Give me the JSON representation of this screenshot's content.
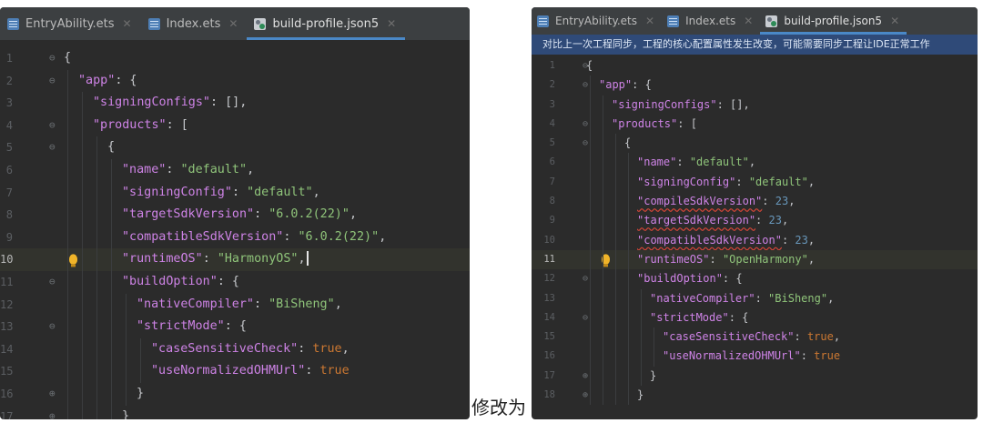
{
  "left": {
    "tabs": [
      {
        "label": "EntryAbility.ets",
        "icon": "ets-file-icon",
        "active": false
      },
      {
        "label": "Index.ets",
        "icon": "ets-file-icon",
        "active": false
      },
      {
        "label": "build-profile.json5",
        "icon": "json5-file-icon",
        "active": true
      }
    ],
    "lines": [
      {
        "num": "1",
        "fold": "⊖",
        "indent": 0,
        "tokens": [
          [
            "p",
            "{"
          ]
        ]
      },
      {
        "num": "2",
        "fold": "⊖",
        "indent": 1,
        "tokens": [
          [
            "k",
            "\"app\""
          ],
          [
            "p",
            ": {"
          ]
        ]
      },
      {
        "num": "3",
        "fold": "",
        "indent": 2,
        "tokens": [
          [
            "k",
            "\"signingConfigs\""
          ],
          [
            "p",
            ": [],"
          ]
        ]
      },
      {
        "num": "4",
        "fold": "⊖",
        "indent": 2,
        "tokens": [
          [
            "k",
            "\"products\""
          ],
          [
            "p",
            ": ["
          ]
        ]
      },
      {
        "num": "5",
        "fold": "⊖",
        "indent": 3,
        "tokens": [
          [
            "p",
            "{"
          ]
        ]
      },
      {
        "num": "6",
        "fold": "",
        "indent": 4,
        "tokens": [
          [
            "k",
            "\"name\""
          ],
          [
            "p",
            ": "
          ],
          [
            "s",
            "\"default\""
          ],
          [
            "p",
            ","
          ]
        ]
      },
      {
        "num": "7",
        "fold": "",
        "indent": 4,
        "tokens": [
          [
            "k",
            "\"signingConfig\""
          ],
          [
            "p",
            ": "
          ],
          [
            "s",
            "\"default\""
          ],
          [
            "p",
            ","
          ]
        ]
      },
      {
        "num": "8",
        "fold": "",
        "indent": 4,
        "tokens": [
          [
            "k",
            "\"targetSdkVersion\""
          ],
          [
            "p",
            ": "
          ],
          [
            "s",
            "\"6.0.2(22)\""
          ],
          [
            "p",
            ","
          ]
        ]
      },
      {
        "num": "9",
        "fold": "",
        "indent": 4,
        "tokens": [
          [
            "k",
            "\"compatibleSdkVersion\""
          ],
          [
            "p",
            ": "
          ],
          [
            "s",
            "\"6.0.2(22)\""
          ],
          [
            "p",
            ","
          ]
        ]
      },
      {
        "num": "10",
        "fold": "",
        "indent": 4,
        "current": true,
        "bulb": true,
        "caret": true,
        "tokens": [
          [
            "k",
            "\"runtimeOS\""
          ],
          [
            "p",
            ": "
          ],
          [
            "s",
            "\"HarmonyOS\""
          ],
          [
            "p",
            ","
          ]
        ]
      },
      {
        "num": "11",
        "fold": "⊖",
        "indent": 4,
        "tokens": [
          [
            "k",
            "\"buildOption\""
          ],
          [
            "p",
            ": {"
          ]
        ]
      },
      {
        "num": "12",
        "fold": "",
        "indent": 5,
        "tokens": [
          [
            "k",
            "\"nativeCompiler\""
          ],
          [
            "p",
            ": "
          ],
          [
            "s",
            "\"BiSheng\""
          ],
          [
            "p",
            ","
          ]
        ]
      },
      {
        "num": "13",
        "fold": "⊖",
        "indent": 5,
        "tokens": [
          [
            "k",
            "\"strictMode\""
          ],
          [
            "p",
            ": {"
          ]
        ]
      },
      {
        "num": "14",
        "fold": "",
        "indent": 6,
        "tokens": [
          [
            "k",
            "\"caseSensitiveCheck\""
          ],
          [
            "p",
            ": "
          ],
          [
            "b",
            "true"
          ],
          [
            "p",
            ","
          ]
        ]
      },
      {
        "num": "15",
        "fold": "",
        "indent": 6,
        "tokens": [
          [
            "k",
            "\"useNormalizedOHMUrl\""
          ],
          [
            "p",
            ": "
          ],
          [
            "b",
            "true"
          ]
        ]
      },
      {
        "num": "16",
        "fold": "⊕",
        "indent": 5,
        "tokens": [
          [
            "p",
            "}"
          ]
        ]
      },
      {
        "num": "17",
        "fold": "⊕",
        "indent": 4,
        "tokens": [
          [
            "p",
            "}"
          ]
        ]
      }
    ]
  },
  "between_label": "修改为",
  "right": {
    "tabs": [
      {
        "label": "EntryAbility.ets",
        "icon": "ets-file-icon",
        "active": false
      },
      {
        "label": "Index.ets",
        "icon": "ets-file-icon",
        "active": false
      },
      {
        "label": "build-profile.json5",
        "icon": "json5-file-icon",
        "active": true
      }
    ],
    "notice": "对比上一次工程同步，工程的核心配置属性发生改变，可能需要同步工程让IDE正常工作",
    "lines": [
      {
        "num": "1",
        "fold": "⊖",
        "indent": 0,
        "tokens": [
          [
            "p",
            "{"
          ]
        ]
      },
      {
        "num": "2",
        "fold": "⊖",
        "indent": 1,
        "tokens": [
          [
            "k",
            "\"app\""
          ],
          [
            "p",
            ": {"
          ]
        ]
      },
      {
        "num": "3",
        "fold": "",
        "indent": 2,
        "tokens": [
          [
            "k",
            "\"signingConfigs\""
          ],
          [
            "p",
            ": [],"
          ]
        ]
      },
      {
        "num": "4",
        "fold": "⊖",
        "indent": 2,
        "tokens": [
          [
            "k",
            "\"products\""
          ],
          [
            "p",
            ": ["
          ]
        ]
      },
      {
        "num": "5",
        "fold": "⊖",
        "indent": 3,
        "tokens": [
          [
            "p",
            "{"
          ]
        ]
      },
      {
        "num": "6",
        "fold": "",
        "indent": 4,
        "tokens": [
          [
            "k",
            "\"name\""
          ],
          [
            "p",
            ": "
          ],
          [
            "s",
            "\"default\""
          ],
          [
            "p",
            ","
          ]
        ]
      },
      {
        "num": "7",
        "fold": "",
        "indent": 4,
        "tokens": [
          [
            "k",
            "\"signingConfig\""
          ],
          [
            "p",
            ": "
          ],
          [
            "s",
            "\"default\""
          ],
          [
            "p",
            ","
          ]
        ]
      },
      {
        "num": "8",
        "fold": "",
        "indent": 4,
        "tokens": [
          [
            "ku",
            "\"compileSdkVersion\""
          ],
          [
            "p",
            ": "
          ],
          [
            "n",
            "23"
          ],
          [
            "p",
            ","
          ]
        ]
      },
      {
        "num": "9",
        "fold": "",
        "indent": 4,
        "tokens": [
          [
            "ku",
            "\"targetSdkVersion\""
          ],
          [
            "p",
            ": "
          ],
          [
            "n",
            "23"
          ],
          [
            "p",
            ","
          ]
        ]
      },
      {
        "num": "10",
        "fold": "",
        "indent": 4,
        "tokens": [
          [
            "ku",
            "\"compatibleSdkVersion\""
          ],
          [
            "p",
            ": "
          ],
          [
            "n",
            "23"
          ],
          [
            "p",
            ","
          ]
        ]
      },
      {
        "num": "11",
        "fold": "",
        "indent": 4,
        "current": true,
        "bulb": true,
        "tokens": [
          [
            "k",
            "\"runtimeOS\""
          ],
          [
            "p",
            ": "
          ],
          [
            "s",
            "\"OpenHarmony\""
          ],
          [
            "p",
            ","
          ]
        ]
      },
      {
        "num": "12",
        "fold": "⊖",
        "indent": 4,
        "tokens": [
          [
            "k",
            "\"buildOption\""
          ],
          [
            "p",
            ": {"
          ]
        ]
      },
      {
        "num": "13",
        "fold": "",
        "indent": 5,
        "tokens": [
          [
            "k",
            "\"nativeCompiler\""
          ],
          [
            "p",
            ": "
          ],
          [
            "s",
            "\"BiSheng\""
          ],
          [
            "p",
            ","
          ]
        ]
      },
      {
        "num": "14",
        "fold": "⊖",
        "indent": 5,
        "tokens": [
          [
            "k",
            "\"strictMode\""
          ],
          [
            "p",
            ": {"
          ]
        ]
      },
      {
        "num": "15",
        "fold": "",
        "indent": 6,
        "tokens": [
          [
            "k",
            "\"caseSensitiveCheck\""
          ],
          [
            "p",
            ": "
          ],
          [
            "b",
            "true"
          ],
          [
            "p",
            ","
          ]
        ]
      },
      {
        "num": "16",
        "fold": "",
        "indent": 6,
        "tokens": [
          [
            "k",
            "\"useNormalizedOHMUrl\""
          ],
          [
            "p",
            ": "
          ],
          [
            "b",
            "true"
          ]
        ]
      },
      {
        "num": "17",
        "fold": "⊕",
        "indent": 5,
        "tokens": [
          [
            "p",
            "}"
          ]
        ]
      },
      {
        "num": "18",
        "fold": "⊕",
        "indent": 4,
        "tokens": [
          [
            "p",
            "}"
          ]
        ]
      }
    ]
  }
}
